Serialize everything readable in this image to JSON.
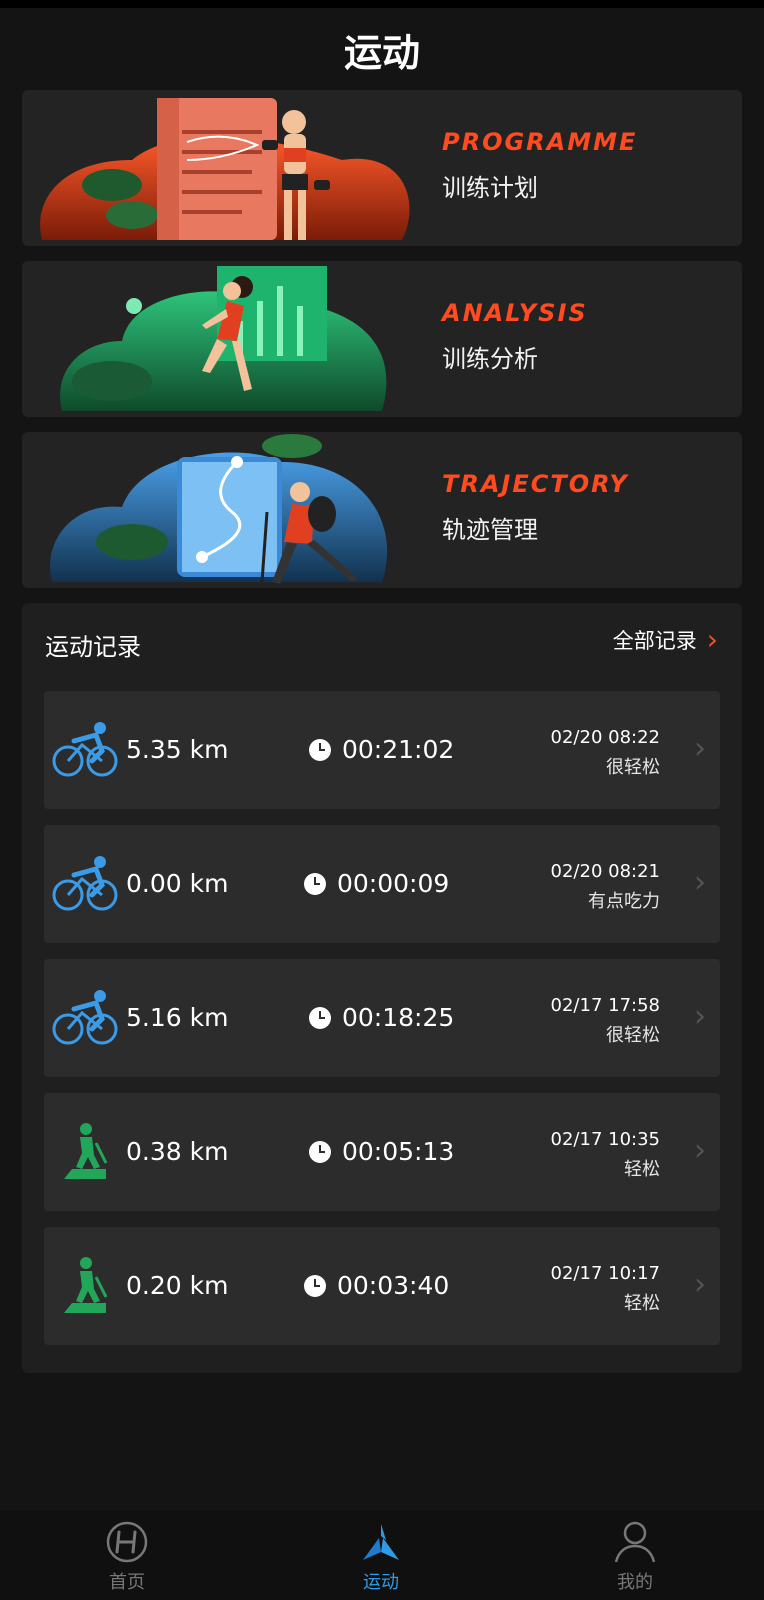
{
  "header": {
    "title": "运动"
  },
  "features": [
    {
      "en": "PROGRAMME",
      "zh": "训练计划"
    },
    {
      "en": "ANALYSIS",
      "zh": "训练分析"
    },
    {
      "en": "TRAJECTORY",
      "zh": "轨迹管理"
    }
  ],
  "records": {
    "title": "运动记录",
    "all_label": "全部记录",
    "items": [
      {
        "sport": "bike-icon",
        "distance": "5.35 km",
        "duration": "00:21:02",
        "date": "02/20 08:22",
        "feeling": "很轻松"
      },
      {
        "sport": "bike-icon",
        "distance": "0.00 km",
        "duration": "00:00:09",
        "date": "02/20 08:21",
        "feeling": "有点吃力"
      },
      {
        "sport": "bike-icon",
        "distance": "5.16 km",
        "duration": "00:18:25",
        "date": "02/17 17:58",
        "feeling": "很轻松"
      },
      {
        "sport": "stepper-icon",
        "distance": "0.38 km",
        "duration": "00:05:13",
        "date": "02/17 10:35",
        "feeling": "轻松"
      },
      {
        "sport": "stepper-icon",
        "distance": "0.20 km",
        "duration": "00:03:40",
        "date": "02/17 10:17",
        "feeling": "轻松"
      }
    ]
  },
  "tabbar": {
    "tabs": [
      {
        "label": "首页",
        "icon": "home-logo-icon"
      },
      {
        "label": "运动",
        "icon": "sport-logo-icon",
        "active": true
      },
      {
        "label": "我的",
        "icon": "profile-icon"
      }
    ]
  },
  "colors": {
    "accent": "#ff4b1f",
    "active_tab": "#2e9be6",
    "bike": "#3a9be8",
    "stepper": "#22a65a"
  }
}
